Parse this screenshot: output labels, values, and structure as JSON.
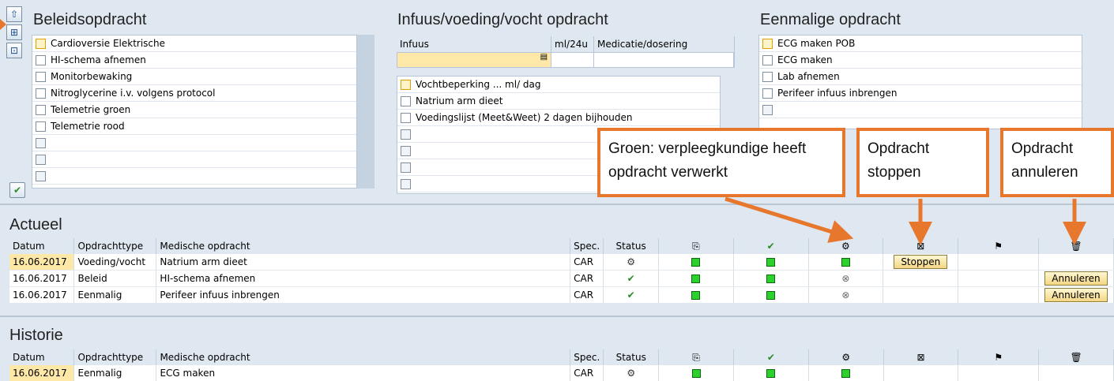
{
  "panels": {
    "beleid": {
      "title": "Beleidsopdracht",
      "items": [
        "Cardioversie Elektrische",
        "HI-schema afnemen",
        "Monitorbewaking",
        "Nitroglycerine i.v. volgens protocol",
        "Telemetrie groen",
        "Telemetrie rood"
      ]
    },
    "infuus": {
      "title": "Infuus/voeding/vocht opdracht",
      "columns": [
        "Infuus",
        "ml/24u",
        "Medicatie/dosering"
      ],
      "items": [
        "Vochtbeperking ... ml/ dag",
        "Natrium arm dieet",
        "Voedingslijst (Meet&Weet) 2 dagen bijhouden"
      ]
    },
    "eenmalig": {
      "title": "Eenmalige opdracht",
      "items": [
        "ECG maken POB",
        "ECG maken",
        "Lab afnemen",
        "Perifeer infuus inbrengen"
      ]
    }
  },
  "callouts": {
    "groen": "Groen: verpleegkundige heeft opdracht verwerkt",
    "stoppen": "Opdracht stoppen",
    "annuleren": "Opdracht annuleren"
  },
  "actueel": {
    "title": "Actueel",
    "columns": [
      "Datum",
      "Opdrachttype",
      "Medische opdracht",
      "Spec.",
      "Status"
    ],
    "rows": [
      {
        "datum": "16.06.2017",
        "type": "Voeding/vocht",
        "opdracht": "Natrium arm dieet",
        "spec": "CAR",
        "status": "gear",
        "gear_col": "green",
        "action": "Stoppen"
      },
      {
        "datum": "16.06.2017",
        "type": "Beleid",
        "opdracht": "HI-schema afnemen",
        "spec": "CAR",
        "status": "check",
        "gear_col": "grey",
        "action": "Annuleren"
      },
      {
        "datum": "16.06.2017",
        "type": "Eenmalig",
        "opdracht": "Perifeer infuus inbrengen",
        "spec": "CAR",
        "status": "check",
        "gear_col": "grey",
        "action": "Annuleren"
      }
    ]
  },
  "historie": {
    "title": "Historie",
    "columns": [
      "Datum",
      "Opdrachttype",
      "Medische opdracht",
      "Spec.",
      "Status"
    ],
    "rows": [
      {
        "datum": "16.06.2017",
        "type": "Eenmalig",
        "opdracht": "ECG maken",
        "spec": "CAR",
        "status": "done"
      }
    ]
  }
}
